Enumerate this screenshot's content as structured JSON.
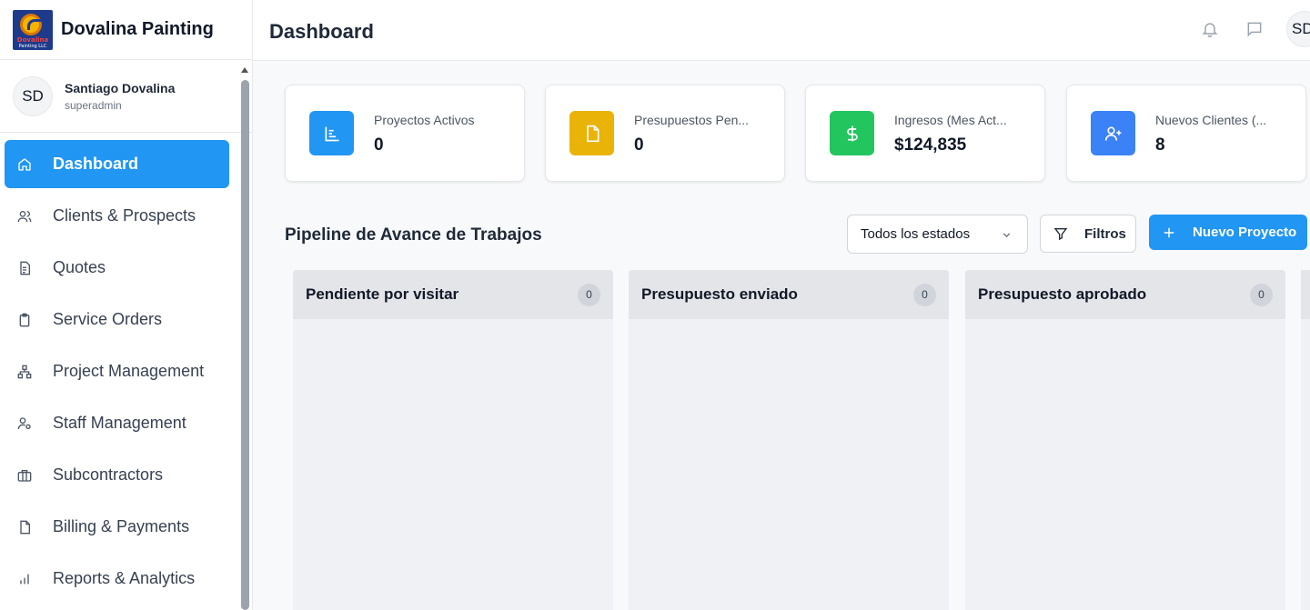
{
  "brand": {
    "name": "Dovalina Painting",
    "logo_text_1": "Dovalina",
    "logo_text_2": "Painting LLC"
  },
  "user": {
    "initials": "SD",
    "name": "Santiago Dovalina",
    "role": "superadmin"
  },
  "sidebar": {
    "items": [
      {
        "label": "Dashboard",
        "icon": "home-icon",
        "active": true
      },
      {
        "label": "Clients & Prospects",
        "icon": "users-icon"
      },
      {
        "label": "Quotes",
        "icon": "document-icon"
      },
      {
        "label": "Service Orders",
        "icon": "clipboard-icon"
      },
      {
        "label": "Project Management",
        "icon": "hierarchy-icon"
      },
      {
        "label": "Staff Management",
        "icon": "user-gear-icon"
      },
      {
        "label": "Subcontractors",
        "icon": "briefcase-icon"
      },
      {
        "label": "Billing & Payments",
        "icon": "file-icon"
      },
      {
        "label": "Reports & Analytics",
        "icon": "bar-chart-icon"
      }
    ]
  },
  "header": {
    "title": "Dashboard",
    "avatar_initials": "SD"
  },
  "stats": [
    {
      "label": "Proyectos Activos",
      "value": "0",
      "color": "#2196f3",
      "icon": "chart-icon"
    },
    {
      "label": "Presupuestos Pen...",
      "value": "0",
      "color": "#eab308",
      "icon": "file-icon"
    },
    {
      "label": "Ingresos (Mes Act...",
      "value": "$124,835",
      "color": "#22c55e",
      "icon": "dollar-icon"
    },
    {
      "label": "Nuevos Clientes (...",
      "value": "8",
      "color": "#3b82f6",
      "icon": "user-plus-icon"
    }
  ],
  "pipeline": {
    "title": "Pipeline de Avance de Trabajos",
    "status_select": "Todos los estados",
    "filter_label": "Filtros",
    "new_project_label": "Nuevo Proyecto",
    "columns": [
      {
        "title": "Pendiente por visitar",
        "count": "0"
      },
      {
        "title": "Presupuesto enviado",
        "count": "0"
      },
      {
        "title": "Presupuesto aprobado",
        "count": "0"
      }
    ]
  }
}
